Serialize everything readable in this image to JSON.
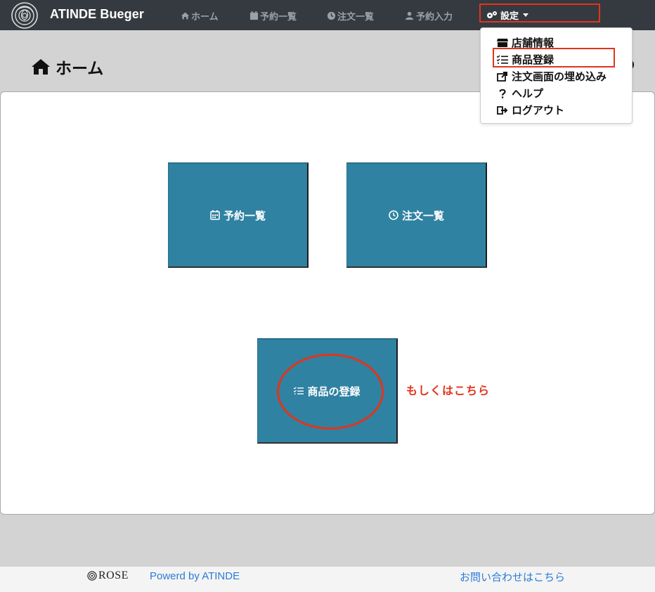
{
  "header": {
    "brand": "ATINDE Bueger",
    "nav": [
      {
        "label": "ホーム",
        "icon": "home-icon"
      },
      {
        "label": "予約一覧",
        "icon": "calendar-icon"
      },
      {
        "label": "注文一覧",
        "icon": "clock-icon"
      },
      {
        "label": "予約入力",
        "icon": "user-edit-icon"
      }
    ],
    "settings_label": "設定"
  },
  "dropdown": {
    "items": [
      {
        "label": "店舗情報",
        "icon": "store-icon"
      },
      {
        "label": "商品登録",
        "icon": "checklist-icon"
      },
      {
        "label": "注文画面の埋め込み",
        "icon": "share-icon"
      },
      {
        "label": "ヘルプ",
        "icon": "question-icon"
      },
      {
        "label": "ログアウト",
        "icon": "sign-out-icon"
      }
    ]
  },
  "page": {
    "title": "ホーム"
  },
  "tiles": {
    "reservations": "予約一覧",
    "orders": "注文一覧",
    "product_register": "商品の登録"
  },
  "annotation": {
    "note": "もしくはこちら",
    "color": "#e2341d"
  },
  "footer": {
    "rose": "ROSE",
    "powered": "Powerd by ATINDE",
    "contact": "お問い合わせはこちら"
  },
  "colors": {
    "navbar": "#343a40",
    "tile": "#2f82a1",
    "link": "#2a7bd6"
  }
}
